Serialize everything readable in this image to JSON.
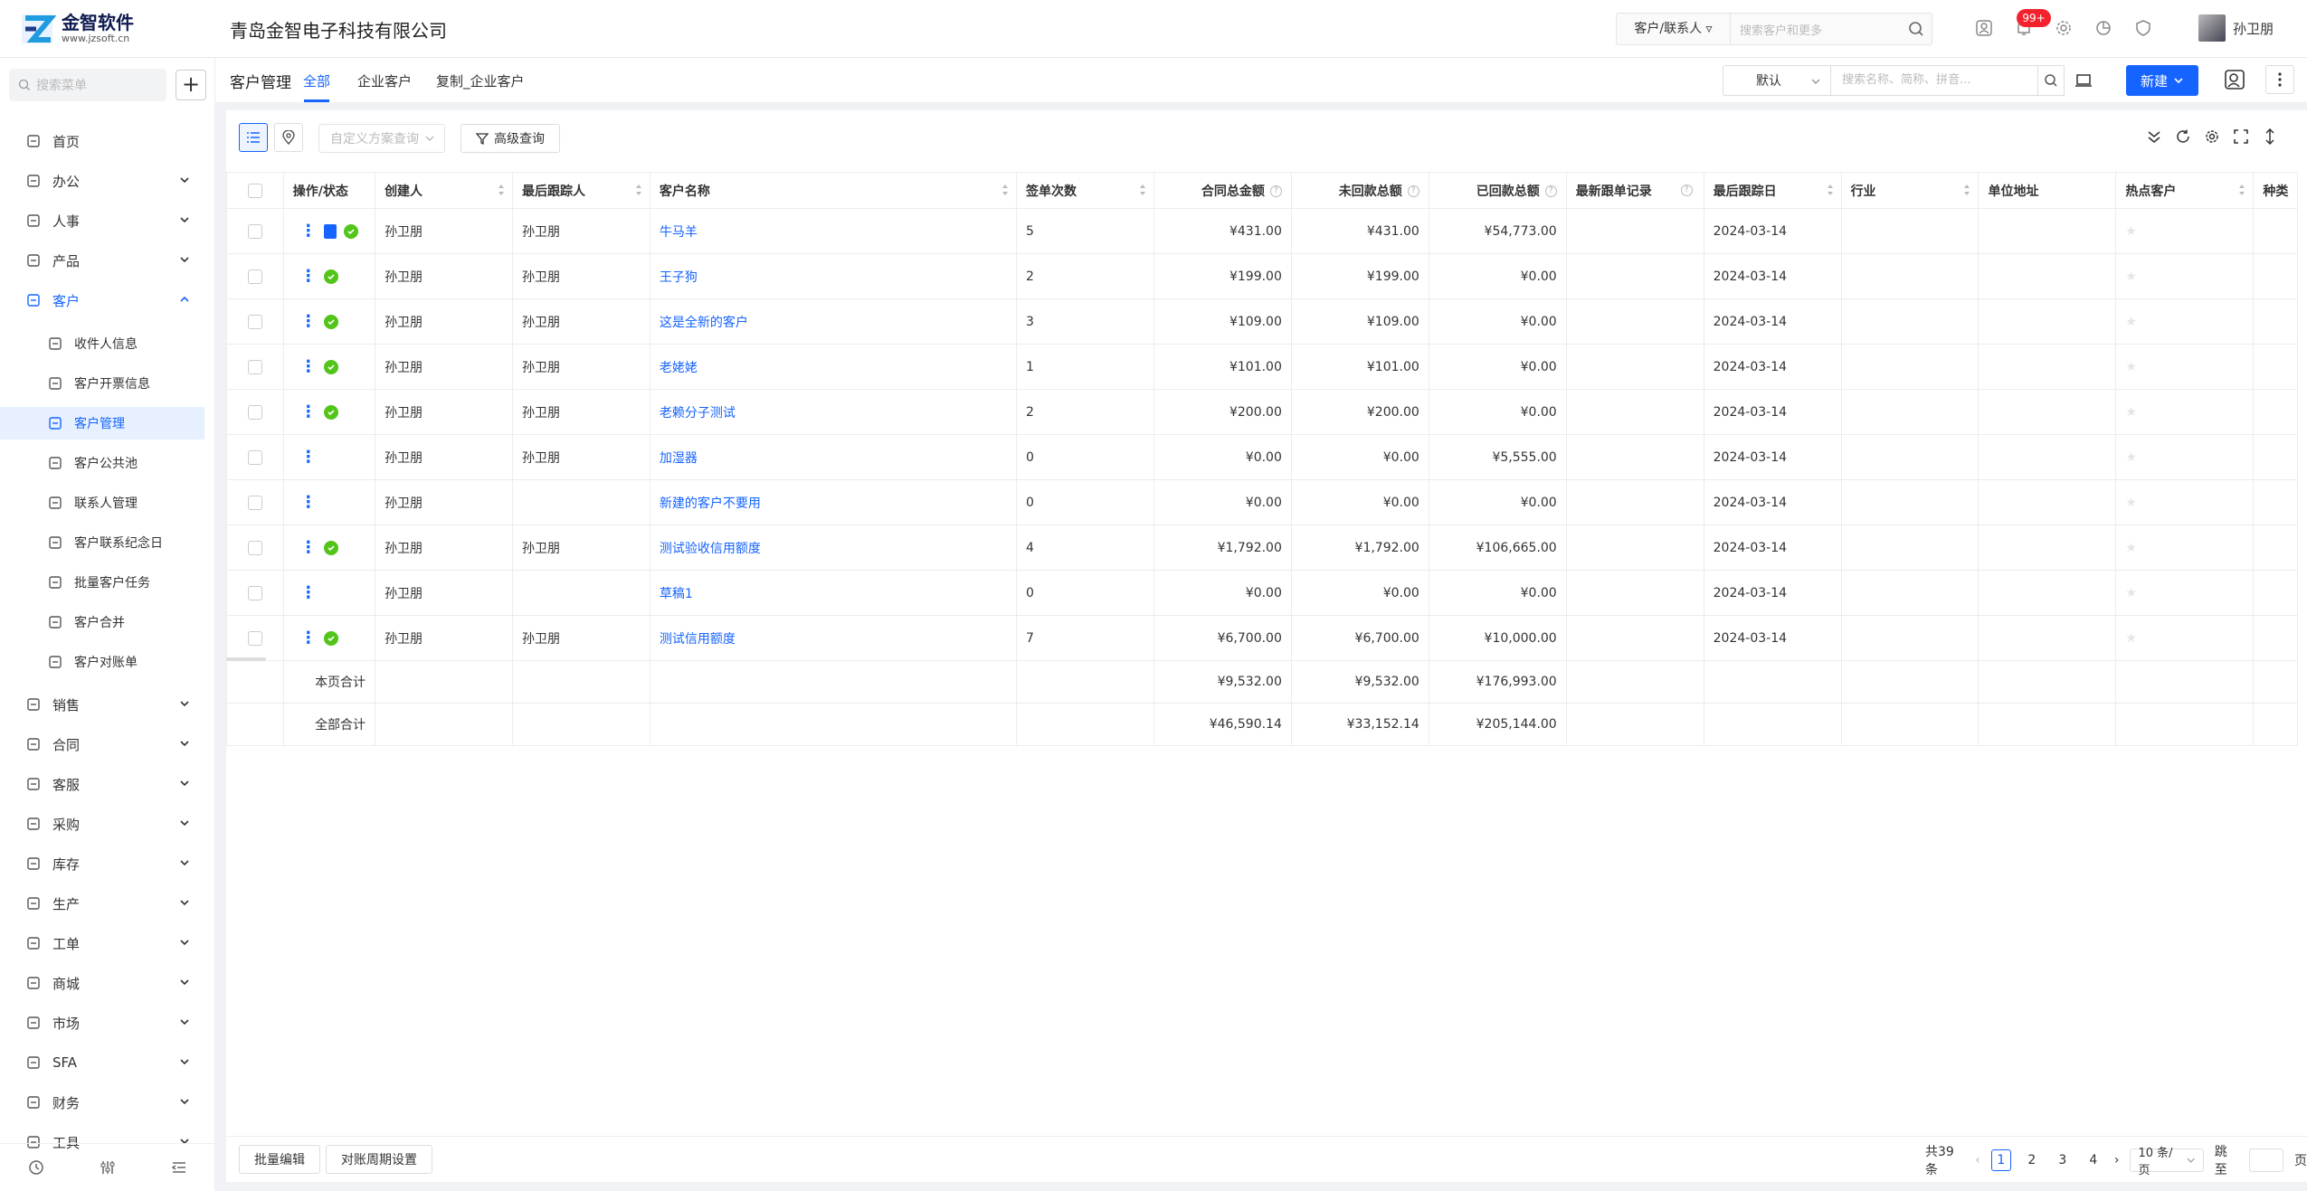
{
  "header": {
    "logo_title": "金智软件",
    "logo_url": "www.jzsoft.cn",
    "company": "青岛金智电子科技有限公司",
    "search_scope": "客户/联系人",
    "search_placeholder": "搜索客户和更多",
    "notif_badge": "99+",
    "user_name": "孙卫朋"
  },
  "sidebar": {
    "search_placeholder": "搜索菜单",
    "add_label": "+",
    "items": [
      {
        "label": "首页",
        "icon": "home-icon"
      },
      {
        "label": "办公",
        "icon": "office-icon"
      },
      {
        "label": "人事",
        "icon": "people-icon"
      },
      {
        "label": "产品",
        "icon": "box-icon"
      },
      {
        "label": "客户",
        "icon": "chart-icon"
      },
      {
        "label": "收件人信息",
        "icon": "speaker-icon"
      },
      {
        "label": "客户开票信息",
        "icon": "speaker-icon"
      },
      {
        "label": "客户管理",
        "icon": "chart-icon"
      },
      {
        "label": "客户公共池",
        "icon": "group-icon"
      },
      {
        "label": "联系人管理",
        "icon": "contact-icon"
      },
      {
        "label": "客户联系纪念日",
        "icon": "calendar-icon"
      },
      {
        "label": "批量客户任务",
        "icon": "task-icon"
      },
      {
        "label": "客户合并",
        "icon": "merge-icon"
      },
      {
        "label": "客户对账单",
        "icon": "statement-icon"
      },
      {
        "label": "销售",
        "icon": "sales-icon"
      },
      {
        "label": "合同",
        "icon": "contract-icon"
      },
      {
        "label": "客服",
        "icon": "service-icon"
      },
      {
        "label": "采购",
        "icon": "cart-icon"
      },
      {
        "label": "库存",
        "icon": "warehouse-icon"
      },
      {
        "label": "生产",
        "icon": "production-icon"
      },
      {
        "label": "工单",
        "icon": "ticket-icon"
      },
      {
        "label": "商城",
        "icon": "shop-icon"
      },
      {
        "label": "市场",
        "icon": "market-icon"
      },
      {
        "label": "SFA",
        "icon": "sfa-icon"
      },
      {
        "label": "财务",
        "icon": "finance-icon"
      },
      {
        "label": "工具",
        "icon": "tool-icon"
      }
    ]
  },
  "page": {
    "title": "客户管理",
    "tabs": [
      "全部",
      "企业客户",
      "复制_企业客户"
    ],
    "view_select": "默认",
    "quick_search_placeholder": "搜索名称、简称、拼音...",
    "new_button": "新建",
    "scheme_placeholder": "自定义方案查询",
    "advanced_query": "高级查询"
  },
  "table": {
    "columns": [
      "操作/状态",
      "创建人",
      "最后跟踪人",
      "客户名称",
      "签单次数",
      "合同总金额",
      "未回款总额",
      "已回款总额",
      "最新跟单记录",
      "最后跟踪日",
      "行业",
      "单位地址",
      "热点客户",
      "种类"
    ],
    "rows": [
      {
        "creator": "孙卫朋",
        "tracker": "孙卫朋",
        "name": "牛马羊",
        "count": "5",
        "contract": "¥431.00",
        "unpaid": "¥431.00",
        "paid": "¥54,773.00",
        "record": "",
        "date": "2024-03-14",
        "doc": true,
        "ok": true
      },
      {
        "creator": "孙卫朋",
        "tracker": "孙卫朋",
        "name": "王子狗",
        "count": "2",
        "contract": "¥199.00",
        "unpaid": "¥199.00",
        "paid": "¥0.00",
        "record": "",
        "date": "2024-03-14",
        "doc": false,
        "ok": true
      },
      {
        "creator": "孙卫朋",
        "tracker": "孙卫朋",
        "name": "这是全新的客户",
        "count": "3",
        "contract": "¥109.00",
        "unpaid": "¥109.00",
        "paid": "¥0.00",
        "record": "",
        "date": "2024-03-14",
        "doc": false,
        "ok": true
      },
      {
        "creator": "孙卫朋",
        "tracker": "孙卫朋",
        "name": "老姥姥",
        "count": "1",
        "contract": "¥101.00",
        "unpaid": "¥101.00",
        "paid": "¥0.00",
        "record": "",
        "date": "2024-03-14",
        "doc": false,
        "ok": true
      },
      {
        "creator": "孙卫朋",
        "tracker": "孙卫朋",
        "name": "老赖分子测试",
        "count": "2",
        "contract": "¥200.00",
        "unpaid": "¥200.00",
        "paid": "¥0.00",
        "record": "",
        "date": "2024-03-14",
        "doc": false,
        "ok": true
      },
      {
        "creator": "孙卫朋",
        "tracker": "孙卫朋",
        "name": "加湿器",
        "count": "0",
        "contract": "¥0.00",
        "unpaid": "¥0.00",
        "paid": "¥5,555.00",
        "record": "",
        "date": "2024-03-14",
        "doc": false,
        "ok": false
      },
      {
        "creator": "孙卫朋",
        "tracker": "",
        "name": "新建的客户不要用",
        "count": "0",
        "contract": "¥0.00",
        "unpaid": "¥0.00",
        "paid": "¥0.00",
        "record": "",
        "date": "2024-03-14",
        "doc": false,
        "ok": false
      },
      {
        "creator": "孙卫朋",
        "tracker": "孙卫朋",
        "name": "测试验收信用额度",
        "count": "4",
        "contract": "¥1,792.00",
        "unpaid": "¥1,792.00",
        "paid": "¥106,665.00",
        "record": "",
        "date": "2024-03-14",
        "doc": false,
        "ok": true
      },
      {
        "creator": "孙卫朋",
        "tracker": "",
        "name": "草稿1",
        "count": "0",
        "contract": "¥0.00",
        "unpaid": "¥0.00",
        "paid": "¥0.00",
        "record": "",
        "date": "2024-03-14",
        "doc": false,
        "ok": false
      },
      {
        "creator": "孙卫朋",
        "tracker": "孙卫朋",
        "name": "测试信用额度",
        "count": "7",
        "contract": "¥6,700.00",
        "unpaid": "¥6,700.00",
        "paid": "¥10,000.00",
        "record": "",
        "date": "2024-03-14",
        "doc": false,
        "ok": true
      }
    ],
    "summary": [
      {
        "label": "本页合计",
        "contract": "¥9,532.00",
        "unpaid": "¥9,532.00",
        "paid": "¥176,993.00"
      },
      {
        "label": "全部合计",
        "contract": "¥46,590.14",
        "unpaid": "¥33,152.14",
        "paid": "¥205,144.00"
      }
    ]
  },
  "footer": {
    "batch_edit": "批量编辑",
    "period_setting": "对账周期设置",
    "total": "共39条",
    "pages": [
      "1",
      "2",
      "3",
      "4"
    ],
    "current_page": "1",
    "page_size": "10 条/页",
    "jump_label": "跳至",
    "page_unit": "页"
  },
  "colors": {
    "accent": "#1664ff",
    "success": "#52c41a",
    "badge": "#f5222d"
  }
}
